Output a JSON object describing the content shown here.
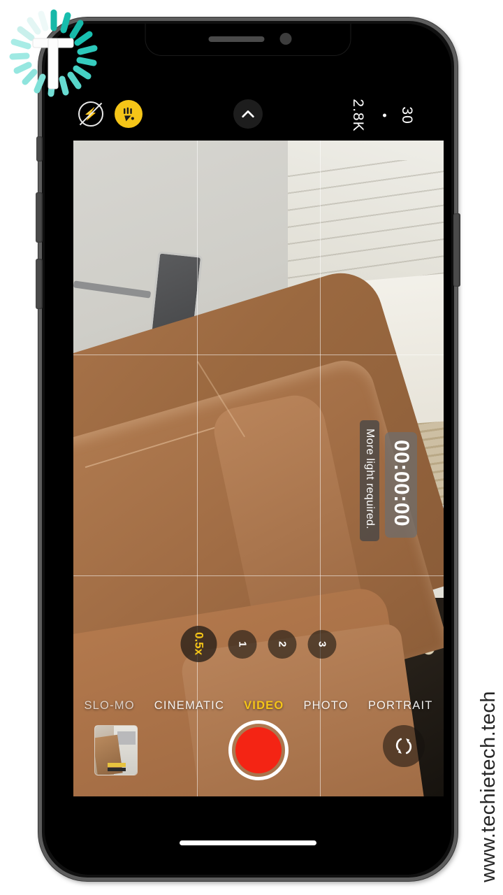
{
  "watermark": {
    "logo_icon": "techietech-logo-icon",
    "site_url": "www.techietech.tech"
  },
  "device": {
    "frame": "iphone-frame",
    "notch_icons": [
      "earpiece-speaker",
      "front-camera"
    ],
    "buttons": [
      "mute-switch",
      "volume-up",
      "volume-down",
      "power"
    ]
  },
  "camera": {
    "topbar": {
      "flash_icon": "flash-off-icon",
      "night_mode_icon": "night-mode-icon",
      "expand_icon": "chevron-up-icon",
      "resolution": "2.8K",
      "frame_rate": "30"
    },
    "viewfinder": {
      "grid": "on",
      "hint": "More light required.",
      "timer": "00:00:00"
    },
    "zoom_levels": [
      {
        "label": "0.5x",
        "active": true
      },
      {
        "label": "1",
        "active": false
      },
      {
        "label": "2",
        "active": false
      },
      {
        "label": "3",
        "active": false
      }
    ],
    "modes": [
      {
        "label": "SLO-MO",
        "active": false
      },
      {
        "label": "CINEMATIC",
        "active": false
      },
      {
        "label": "VIDEO",
        "active": true
      },
      {
        "label": "PHOTO",
        "active": false
      },
      {
        "label": "PORTRAIT",
        "active": false
      }
    ],
    "controls": {
      "thumbnail": "last-capture-thumbnail",
      "record_button": "record-button",
      "flip_icon": "flip-camera-icon"
    },
    "colors": {
      "accent_yellow": "#f5c518",
      "record_red": "#f42414",
      "night_badge": "#f5c518"
    }
  }
}
